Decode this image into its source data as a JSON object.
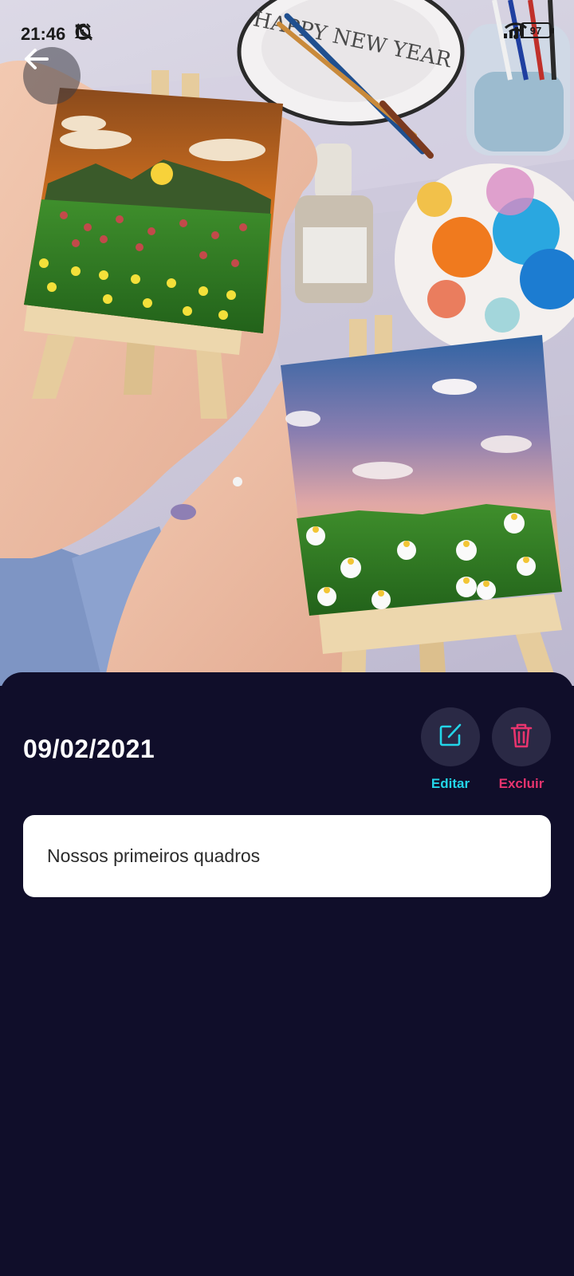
{
  "status_bar": {
    "time": "21:46",
    "battery": "97"
  },
  "photo": {
    "plate_text": "HAPPY NEW YEAR"
  },
  "detail": {
    "date": "09/02/2021",
    "edit_label": "Editar",
    "delete_label": "Excluir",
    "note_text": "Nossos primeiros quadros"
  },
  "colors": {
    "sheet_background": "#100e2a",
    "edit_accent": "#23d5e8",
    "delete_accent": "#e8346e",
    "action_circle": "#2a2945"
  }
}
